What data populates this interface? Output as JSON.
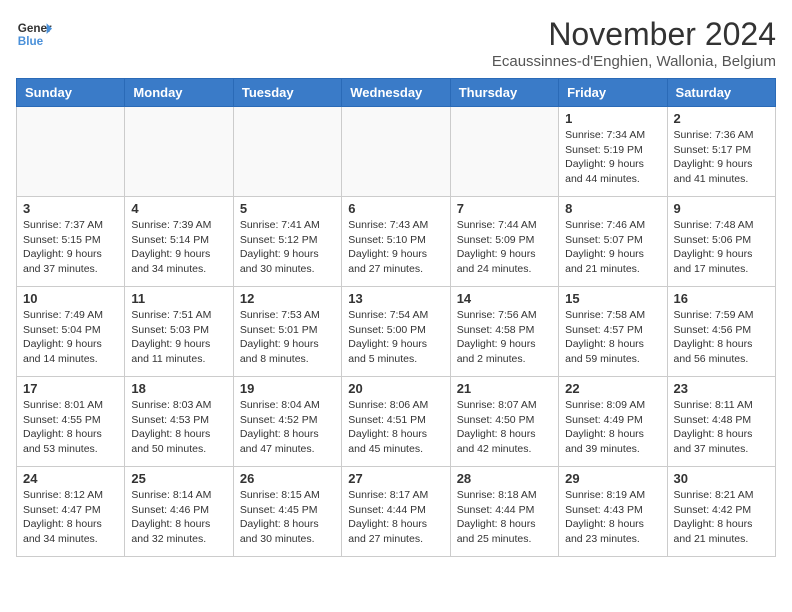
{
  "logo": {
    "line1": "General",
    "line2": "Blue"
  },
  "title": "November 2024",
  "subtitle": "Ecaussinnes-d'Enghien, Wallonia, Belgium",
  "headers": [
    "Sunday",
    "Monday",
    "Tuesday",
    "Wednesday",
    "Thursday",
    "Friday",
    "Saturday"
  ],
  "weeks": [
    [
      {
        "day": "",
        "info": ""
      },
      {
        "day": "",
        "info": ""
      },
      {
        "day": "",
        "info": ""
      },
      {
        "day": "",
        "info": ""
      },
      {
        "day": "",
        "info": ""
      },
      {
        "day": "1",
        "info": "Sunrise: 7:34 AM\nSunset: 5:19 PM\nDaylight: 9 hours and 44 minutes."
      },
      {
        "day": "2",
        "info": "Sunrise: 7:36 AM\nSunset: 5:17 PM\nDaylight: 9 hours and 41 minutes."
      }
    ],
    [
      {
        "day": "3",
        "info": "Sunrise: 7:37 AM\nSunset: 5:15 PM\nDaylight: 9 hours and 37 minutes."
      },
      {
        "day": "4",
        "info": "Sunrise: 7:39 AM\nSunset: 5:14 PM\nDaylight: 9 hours and 34 minutes."
      },
      {
        "day": "5",
        "info": "Sunrise: 7:41 AM\nSunset: 5:12 PM\nDaylight: 9 hours and 30 minutes."
      },
      {
        "day": "6",
        "info": "Sunrise: 7:43 AM\nSunset: 5:10 PM\nDaylight: 9 hours and 27 minutes."
      },
      {
        "day": "7",
        "info": "Sunrise: 7:44 AM\nSunset: 5:09 PM\nDaylight: 9 hours and 24 minutes."
      },
      {
        "day": "8",
        "info": "Sunrise: 7:46 AM\nSunset: 5:07 PM\nDaylight: 9 hours and 21 minutes."
      },
      {
        "day": "9",
        "info": "Sunrise: 7:48 AM\nSunset: 5:06 PM\nDaylight: 9 hours and 17 minutes."
      }
    ],
    [
      {
        "day": "10",
        "info": "Sunrise: 7:49 AM\nSunset: 5:04 PM\nDaylight: 9 hours and 14 minutes."
      },
      {
        "day": "11",
        "info": "Sunrise: 7:51 AM\nSunset: 5:03 PM\nDaylight: 9 hours and 11 minutes."
      },
      {
        "day": "12",
        "info": "Sunrise: 7:53 AM\nSunset: 5:01 PM\nDaylight: 9 hours and 8 minutes."
      },
      {
        "day": "13",
        "info": "Sunrise: 7:54 AM\nSunset: 5:00 PM\nDaylight: 9 hours and 5 minutes."
      },
      {
        "day": "14",
        "info": "Sunrise: 7:56 AM\nSunset: 4:58 PM\nDaylight: 9 hours and 2 minutes."
      },
      {
        "day": "15",
        "info": "Sunrise: 7:58 AM\nSunset: 4:57 PM\nDaylight: 8 hours and 59 minutes."
      },
      {
        "day": "16",
        "info": "Sunrise: 7:59 AM\nSunset: 4:56 PM\nDaylight: 8 hours and 56 minutes."
      }
    ],
    [
      {
        "day": "17",
        "info": "Sunrise: 8:01 AM\nSunset: 4:55 PM\nDaylight: 8 hours and 53 minutes."
      },
      {
        "day": "18",
        "info": "Sunrise: 8:03 AM\nSunset: 4:53 PM\nDaylight: 8 hours and 50 minutes."
      },
      {
        "day": "19",
        "info": "Sunrise: 8:04 AM\nSunset: 4:52 PM\nDaylight: 8 hours and 47 minutes."
      },
      {
        "day": "20",
        "info": "Sunrise: 8:06 AM\nSunset: 4:51 PM\nDaylight: 8 hours and 45 minutes."
      },
      {
        "day": "21",
        "info": "Sunrise: 8:07 AM\nSunset: 4:50 PM\nDaylight: 8 hours and 42 minutes."
      },
      {
        "day": "22",
        "info": "Sunrise: 8:09 AM\nSunset: 4:49 PM\nDaylight: 8 hours and 39 minutes."
      },
      {
        "day": "23",
        "info": "Sunrise: 8:11 AM\nSunset: 4:48 PM\nDaylight: 8 hours and 37 minutes."
      }
    ],
    [
      {
        "day": "24",
        "info": "Sunrise: 8:12 AM\nSunset: 4:47 PM\nDaylight: 8 hours and 34 minutes."
      },
      {
        "day": "25",
        "info": "Sunrise: 8:14 AM\nSunset: 4:46 PM\nDaylight: 8 hours and 32 minutes."
      },
      {
        "day": "26",
        "info": "Sunrise: 8:15 AM\nSunset: 4:45 PM\nDaylight: 8 hours and 30 minutes."
      },
      {
        "day": "27",
        "info": "Sunrise: 8:17 AM\nSunset: 4:44 PM\nDaylight: 8 hours and 27 minutes."
      },
      {
        "day": "28",
        "info": "Sunrise: 8:18 AM\nSunset: 4:44 PM\nDaylight: 8 hours and 25 minutes."
      },
      {
        "day": "29",
        "info": "Sunrise: 8:19 AM\nSunset: 4:43 PM\nDaylight: 8 hours and 23 minutes."
      },
      {
        "day": "30",
        "info": "Sunrise: 8:21 AM\nSunset: 4:42 PM\nDaylight: 8 hours and 21 minutes."
      }
    ]
  ]
}
